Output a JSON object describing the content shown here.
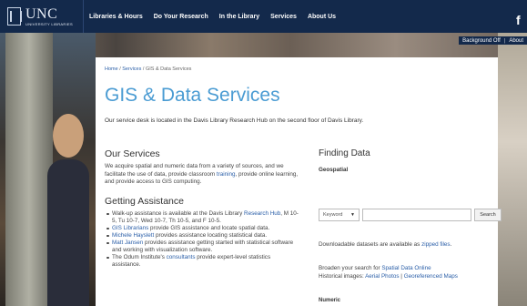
{
  "brand": {
    "name": "UNC",
    "sub": "UNIVERSITY LIBRARIES"
  },
  "nav": [
    "Libraries & Hours",
    "Do Your Research",
    "In the Library",
    "Services",
    "About Us"
  ],
  "social": {
    "icon": "facebook-icon",
    "glyph": "f"
  },
  "bg_toggle": {
    "label": "Background Off",
    "separator": "|",
    "about": "About"
  },
  "breadcrumb": {
    "home": "Home",
    "sep1": " / ",
    "services": "Services",
    "sep2": " / ",
    "current": "GIS & Data Services"
  },
  "page": {
    "title": "GIS & Data Services",
    "intro": "Our service desk is located in the Davis Library Research Hub on the second floor of Davis Library."
  },
  "our_services": {
    "heading": "Our Services",
    "text_a": "We acquire spatial and numeric data from a variety of sources, and we facilitate the use of data, provide classroom ",
    "link_training": "training",
    "text_b": ", provide online learning, and provide access to GIS computing."
  },
  "getting_assistance": {
    "heading": "Getting Assistance",
    "items": [
      {
        "pre": "Walk-up assistance is available at the Davis Library ",
        "link": "Research Hub",
        "post": ", M 10-5, Tu 10-7, Wed 10-7, Th 10-5, and F 10-5."
      },
      {
        "pre": "",
        "link": "GIS Librarians",
        "post": " provide GIS assistance and locate spatial data."
      },
      {
        "pre": "",
        "link": "Michele Hayslett",
        "post": " provides assistance locating statistical data."
      },
      {
        "pre": "",
        "link": "Matt Jansen",
        "post": " provides assistance getting started with statistical software and working with visualization software."
      },
      {
        "pre": "The Odum Institute's ",
        "link": "consultants",
        "post": " provide expert-level statistics assistance."
      }
    ]
  },
  "finding_data": {
    "heading": "Finding Data",
    "geospatial": "Geospatial",
    "search": {
      "select_value": "Keyword",
      "button": "Search",
      "input_value": ""
    },
    "zipped_pre": "Downloadable datasets are available as ",
    "zipped_link": "zipped files",
    "zipped_post": ".",
    "broaden_pre": "Broaden your search for ",
    "broaden_link": "Spatial Data Online",
    "hist_pre": "Historical images: ",
    "hist_link1": "Aerial Photos",
    "hist_sep": " | ",
    "hist_link2": "Georeferenced Maps",
    "numeric": "Numeric"
  }
}
